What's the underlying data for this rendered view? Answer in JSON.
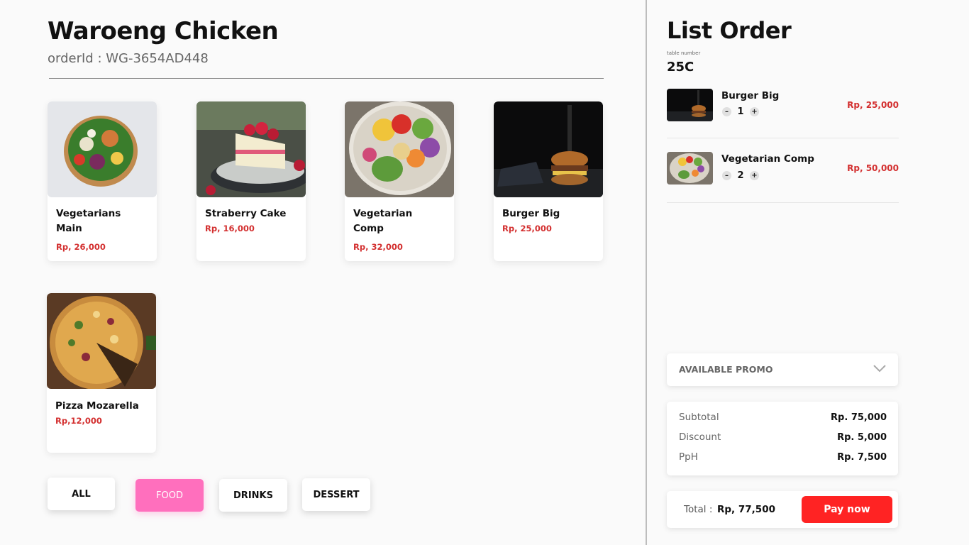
{
  "store": {
    "name": "Waroeng Chicken",
    "order_id_label": "orderId : WG-3654AD448"
  },
  "menu": [
    {
      "name": "Vegetarians Main",
      "price": "Rp, 26,000",
      "image": "salad-bowl"
    },
    {
      "name": "Straberry Cake",
      "price": "Rp, 16,000",
      "image": "strawberry-cake"
    },
    {
      "name": "Vegetarian Comp",
      "price": "Rp, 32,000",
      "image": "veggie-bowl"
    },
    {
      "name": "Burger Big",
      "price": "Rp, 25,000",
      "image": "burger"
    },
    {
      "name": "Pizza Mozarella",
      "price": "Rp,12,000",
      "image": "pizza"
    }
  ],
  "filters": [
    {
      "label": "ALL",
      "active": false
    },
    {
      "label": "FOOD",
      "active": true
    },
    {
      "label": "DRINKS",
      "active": false
    },
    {
      "label": "DESSERT",
      "active": false
    }
  ],
  "order": {
    "title": "List Order",
    "table_label": "table number",
    "table_number": "25C",
    "items": [
      {
        "name": "Burger Big",
        "qty": "1",
        "price": "Rp, 25,000",
        "image": "burger",
        "minus": "–",
        "plus": "+"
      },
      {
        "name": "Vegetarian Comp",
        "qty": "2",
        "price": "Rp, 50,000",
        "image": "veggie-bowl",
        "minus": "–",
        "plus": "+"
      }
    ],
    "promo_label": "AVAILABLE PROMO",
    "summary": {
      "subtotal_label": "Subtotal",
      "subtotal_value": "Rp. 75,000",
      "discount_label": "Discount",
      "discount_value": "Rp. 5,000",
      "pph_label": "PpH",
      "pph_value": "Rp. 7,500"
    },
    "total_label": "Total :",
    "total_value": "Rp, 77,500",
    "pay_label": "Pay now"
  },
  "colors": {
    "price_red": "#d32f2f",
    "active_filter": "#ff6fbd",
    "pay_button": "#ff2323"
  }
}
